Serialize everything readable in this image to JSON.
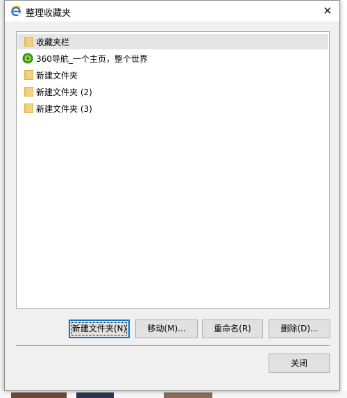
{
  "dialog": {
    "title": "整理收藏夹",
    "close_symbol": "✕"
  },
  "list": {
    "items": [
      {
        "label": "收藏夹栏",
        "icon": "folder-icon",
        "selected": true
      },
      {
        "label": "360导航_一个主页，整个世界",
        "icon": "green-globe-icon",
        "selected": false
      },
      {
        "label": "新建文件夹",
        "icon": "folder-icon",
        "selected": false
      },
      {
        "label": "新建文件夹 (2)",
        "icon": "folder-icon",
        "selected": false
      },
      {
        "label": "新建文件夹 (3)",
        "icon": "folder-icon",
        "selected": false
      }
    ]
  },
  "buttons": {
    "new_folder": "新建文件夹(N)",
    "move": "移动(M)...",
    "rename": "重命名(R)",
    "delete": "删除(D)...",
    "close": "关闭"
  },
  "colors": {
    "folder": "#f2d27a",
    "folder_dark": "#d9b24c",
    "accent": "#0078d7",
    "ie_blue": "#1e74c9",
    "nav_green": "#2aa63a"
  }
}
